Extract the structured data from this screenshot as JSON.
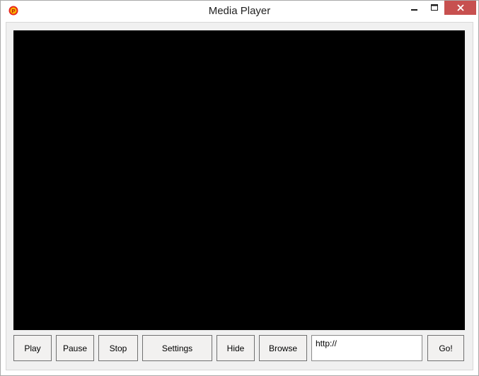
{
  "window": {
    "title": "Media Player"
  },
  "titlebar": {
    "app_icon": "app-logo-icon",
    "minimize_icon": "minimize-icon",
    "maximize_icon": "maximize-icon",
    "close_icon": "close-icon",
    "close_color": "#c7504f"
  },
  "video": {
    "background": "#000000"
  },
  "controls": {
    "play": "Play",
    "pause": "Pause",
    "stop": "Stop",
    "settings": "Settings",
    "hide": "Hide",
    "browse": "Browse",
    "url_value": "http://",
    "go": "Go!"
  }
}
